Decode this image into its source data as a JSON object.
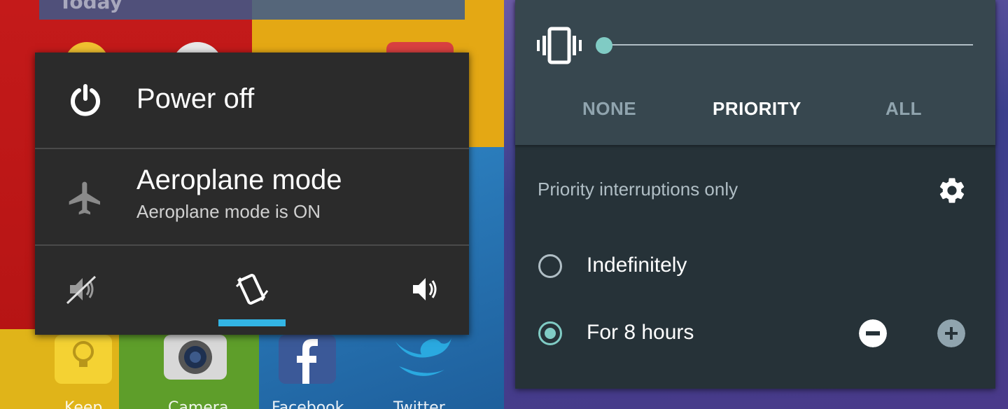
{
  "left_panel": {
    "power_menu": {
      "power_off_label": "Power off",
      "aeroplane_title": "Aeroplane mode",
      "aeroplane_status": "Aeroplane mode is ON",
      "sound_modes": {
        "selected": "vibrate",
        "icons": [
          "silent-icon",
          "vibrate-icon",
          "sound-on-icon"
        ]
      }
    },
    "home_screen": {
      "widget_text": "Today",
      "dock_labels": [
        "Keep",
        "Camera",
        "Facebook",
        "Twitter"
      ]
    }
  },
  "right_panel": {
    "modes": [
      "NONE",
      "PRIORITY",
      "ALL"
    ],
    "selected_mode": "PRIORITY",
    "volume_level": 0,
    "priority_label": "Priority interruptions only",
    "options": [
      {
        "label": "Indefinitely",
        "selected": false
      },
      {
        "label": "For 8 hours",
        "selected": true
      }
    ]
  },
  "colors": {
    "accent_blue": "#33b5e5",
    "accent_teal": "#80cbc4",
    "menu_bg": "#2b2b2b",
    "panel_bg": "#263238",
    "panel_top_bg": "#37474f"
  }
}
